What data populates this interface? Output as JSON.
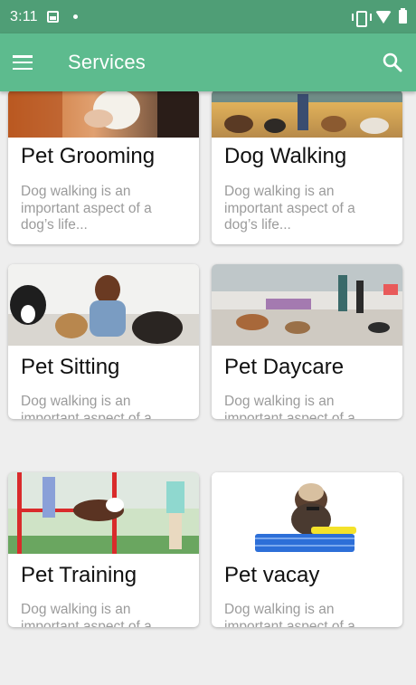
{
  "status_bar": {
    "time": "3:11"
  },
  "app_bar": {
    "title": "Services"
  },
  "cards": [
    {
      "title": "Pet Grooming",
      "description": "Dog walking is an important aspect of a dog’s life..."
    },
    {
      "title": "Dog Walking",
      "description": "Dog walking is an important aspect of a dog’s life..."
    },
    {
      "title": "Pet Sitting",
      "description": "Dog walking is an important aspect of a dog’s life..."
    },
    {
      "title": "Pet Daycare",
      "description": "Dog walking is an important aspect of a dog’s life..."
    },
    {
      "title": "Pet Training",
      "description": "Dog walking is an important aspect of a dog’s life..."
    },
    {
      "title": "Pet vacay",
      "description": "Dog walking is an important aspect of a dog’s life..."
    }
  ],
  "colors": {
    "status_bar": "#4f9e76",
    "app_bar": "#5dbb8e",
    "background": "#eeeeee",
    "card": "#ffffff",
    "description": "#9b9b9b"
  },
  "icons": {
    "menu": "menu-icon",
    "search": "search-icon"
  }
}
